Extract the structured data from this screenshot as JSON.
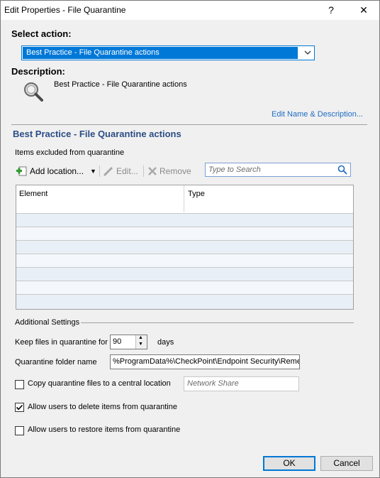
{
  "window": {
    "title": "Edit Properties - File Quarantine",
    "help_label": "?",
    "close_label": "✕"
  },
  "action": {
    "section_label": "Select action:",
    "selected": "Best Practice - File Quarantine actions"
  },
  "description": {
    "section_label": "Description:",
    "text": "Best Practice - File Quarantine actions",
    "edit_link": "Edit Name & Description..."
  },
  "details": {
    "heading": "Best Practice - File Quarantine actions",
    "excluded_label": "Items excluded from quarantine",
    "toolbar": {
      "add_label": "Add location...",
      "edit_label": "Edit...",
      "remove_label": "Remove",
      "search_placeholder": "Type to Search"
    },
    "table": {
      "columns": [
        "Element",
        "Type"
      ],
      "rows": []
    }
  },
  "additional": {
    "section_label": "Additional Settings",
    "keep_label": "Keep files in quarantine for",
    "keep_value": "90",
    "keep_unit": "days",
    "folder_label": "Quarantine folder name",
    "folder_value": "%ProgramData%\\CheckPoint\\Endpoint Security\\Reme",
    "copy_label": "Copy quarantine files to a central location",
    "copy_checked": false,
    "network_share_placeholder": "Network Share",
    "delete_label": "Allow users to delete items from quarantine",
    "delete_checked": true,
    "restore_label": "Allow users to restore items from quarantine",
    "restore_checked": false
  },
  "buttons": {
    "ok_label": "OK",
    "cancel_label": "Cancel"
  },
  "colors": {
    "accent": "#0078d7",
    "heading": "#2b4d86",
    "link": "#1f6bc4"
  }
}
